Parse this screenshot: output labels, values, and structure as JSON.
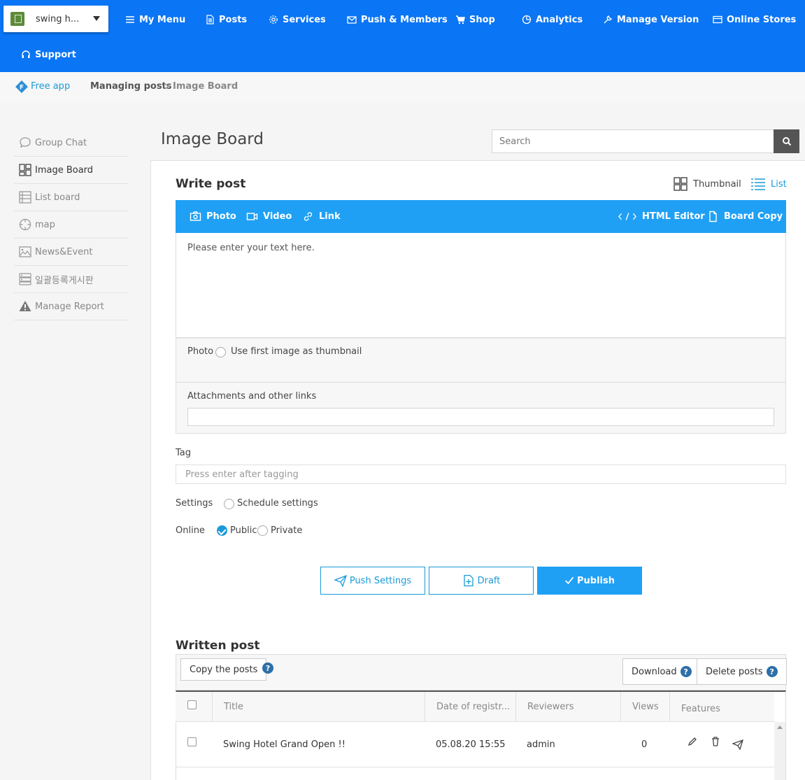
{
  "app": {
    "name": "swing h..."
  },
  "nav": {
    "items": [
      {
        "label": "My Menu",
        "icon": "menu-lines-icon"
      },
      {
        "label": "Posts",
        "icon": "document-icon"
      },
      {
        "label": "Services",
        "icon": "gear-icon"
      },
      {
        "label": "Push & Members",
        "icon": "envelope-icon"
      },
      {
        "label": "Shop",
        "icon": "cart-icon"
      },
      {
        "label": "Analytics",
        "icon": "pie-chart-icon"
      },
      {
        "label": "Manage Version",
        "icon": "wrench-icon"
      },
      {
        "label": "Online Stores",
        "icon": "card-icon"
      },
      {
        "label": "Support",
        "icon": "headset-icon"
      }
    ]
  },
  "breadcrumb": {
    "root": "Free app",
    "root_badge": "F",
    "section": "Managing posts",
    "separator": ">",
    "current": "Image Board"
  },
  "sidebar": {
    "items": [
      {
        "label": "Group Chat",
        "icon": "chat-bubble-icon",
        "active": false
      },
      {
        "label": "Image Board",
        "icon": "image-grid-icon",
        "active": true
      },
      {
        "label": "List board",
        "icon": "list-board-icon",
        "active": false
      },
      {
        "label": "map",
        "icon": "map-target-icon",
        "active": false
      },
      {
        "label": "News&Event",
        "icon": "picture-icon",
        "active": false
      },
      {
        "label": "일괄등록게시판",
        "icon": "bulk-board-icon",
        "active": false
      },
      {
        "label": "Manage Report",
        "icon": "warning-icon",
        "active": false
      }
    ]
  },
  "page": {
    "title": "Image Board"
  },
  "search": {
    "placeholder": "Search"
  },
  "write": {
    "heading": "Write post",
    "view_thumbnail": "Thumbnail",
    "view_list": "List",
    "toolbar": {
      "photo": "Photo",
      "video": "Video",
      "link": "Link",
      "html_editor": "HTML Editor",
      "board_copy": "Board Copy"
    },
    "editor_placeholder": "Please enter your text here.",
    "photo_label": "Photo",
    "thumbnail_option": "Use first image as thumbnail",
    "attachments_label": "Attachments and other links",
    "tag_label": "Tag",
    "tag_placeholder": "Press enter after tagging",
    "settings_label": "Settings",
    "schedule_option": "Schedule settings",
    "online_label": "Online",
    "public_option": "Public",
    "private_option": "Private",
    "online_selected": "Public",
    "push_settings": "Push Settings",
    "draft": "Draft",
    "publish": "Publish"
  },
  "written": {
    "heading": "Written post",
    "copy_posts": "Copy the posts",
    "download": "Download",
    "delete_posts": "Delete posts",
    "help": "?",
    "columns": [
      "Title",
      "Date of registr...",
      "Reviewers",
      "Views",
      "Features"
    ],
    "rows": [
      {
        "title": "Swing Hotel Grand Open !!",
        "date": "05.08.20 15:55",
        "reviewer": "admin",
        "views": "0"
      }
    ]
  },
  "colors": {
    "nav_bg": "#0a75f5",
    "accent": "#1fa0f5",
    "link": "#1a9ad9",
    "help": "#2e6fa8"
  }
}
